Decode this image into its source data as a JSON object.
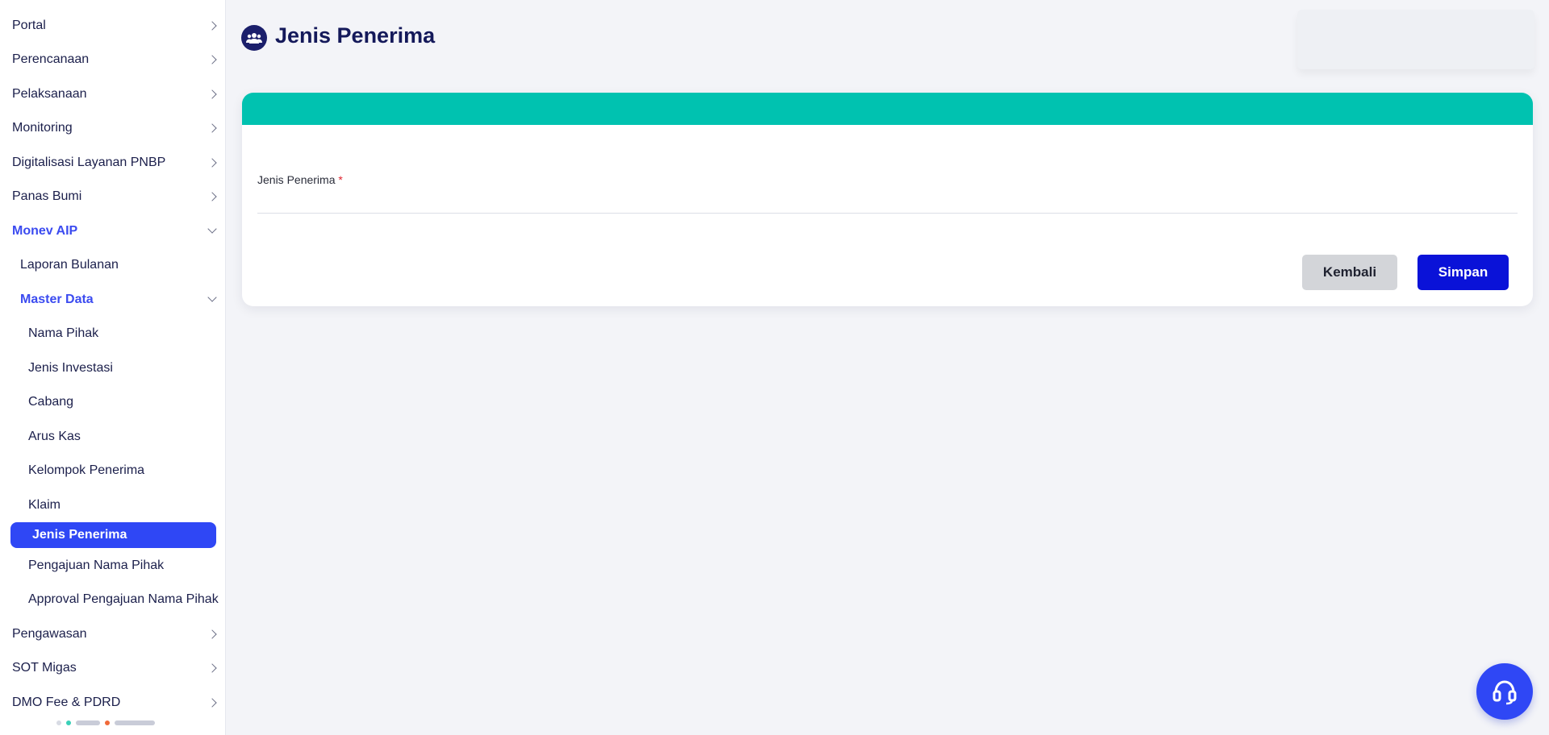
{
  "sidebar": {
    "items": [
      {
        "label": "Portal"
      },
      {
        "label": "Perencanaan"
      },
      {
        "label": "Pelaksanaan"
      },
      {
        "label": "Monitoring"
      },
      {
        "label": "Digitalisasi Layanan PNBP"
      },
      {
        "label": "Panas Bumi"
      },
      {
        "label": "Monev AIP"
      },
      {
        "label": "Laporan Bulanan"
      },
      {
        "label": "Master Data"
      },
      {
        "label": "Nama Pihak"
      },
      {
        "label": "Jenis Investasi"
      },
      {
        "label": "Cabang"
      },
      {
        "label": "Arus Kas"
      },
      {
        "label": "Kelompok Penerima"
      },
      {
        "label": "Klaim"
      },
      {
        "label": "Jenis Penerima"
      },
      {
        "label": "Pengajuan Nama Pihak"
      },
      {
        "label": "Approval Pengajuan Nama Pihak"
      },
      {
        "label": "Pengawasan"
      },
      {
        "label": "SOT Migas"
      },
      {
        "label": "DMO Fee & PDRD"
      }
    ]
  },
  "header": {
    "title": "Jenis Penerima",
    "icon": "users-icon"
  },
  "form": {
    "field_label": "Jenis Penerima",
    "required_mark": "*",
    "field_value": "",
    "back_label": "Kembali",
    "save_label": "Simpan"
  },
  "colors": {
    "accent": "#2f47f5",
    "card_header": "#00c2b0",
    "save_button": "#0a12d8",
    "title": "#14195a"
  },
  "help": {
    "icon": "headset-icon"
  }
}
